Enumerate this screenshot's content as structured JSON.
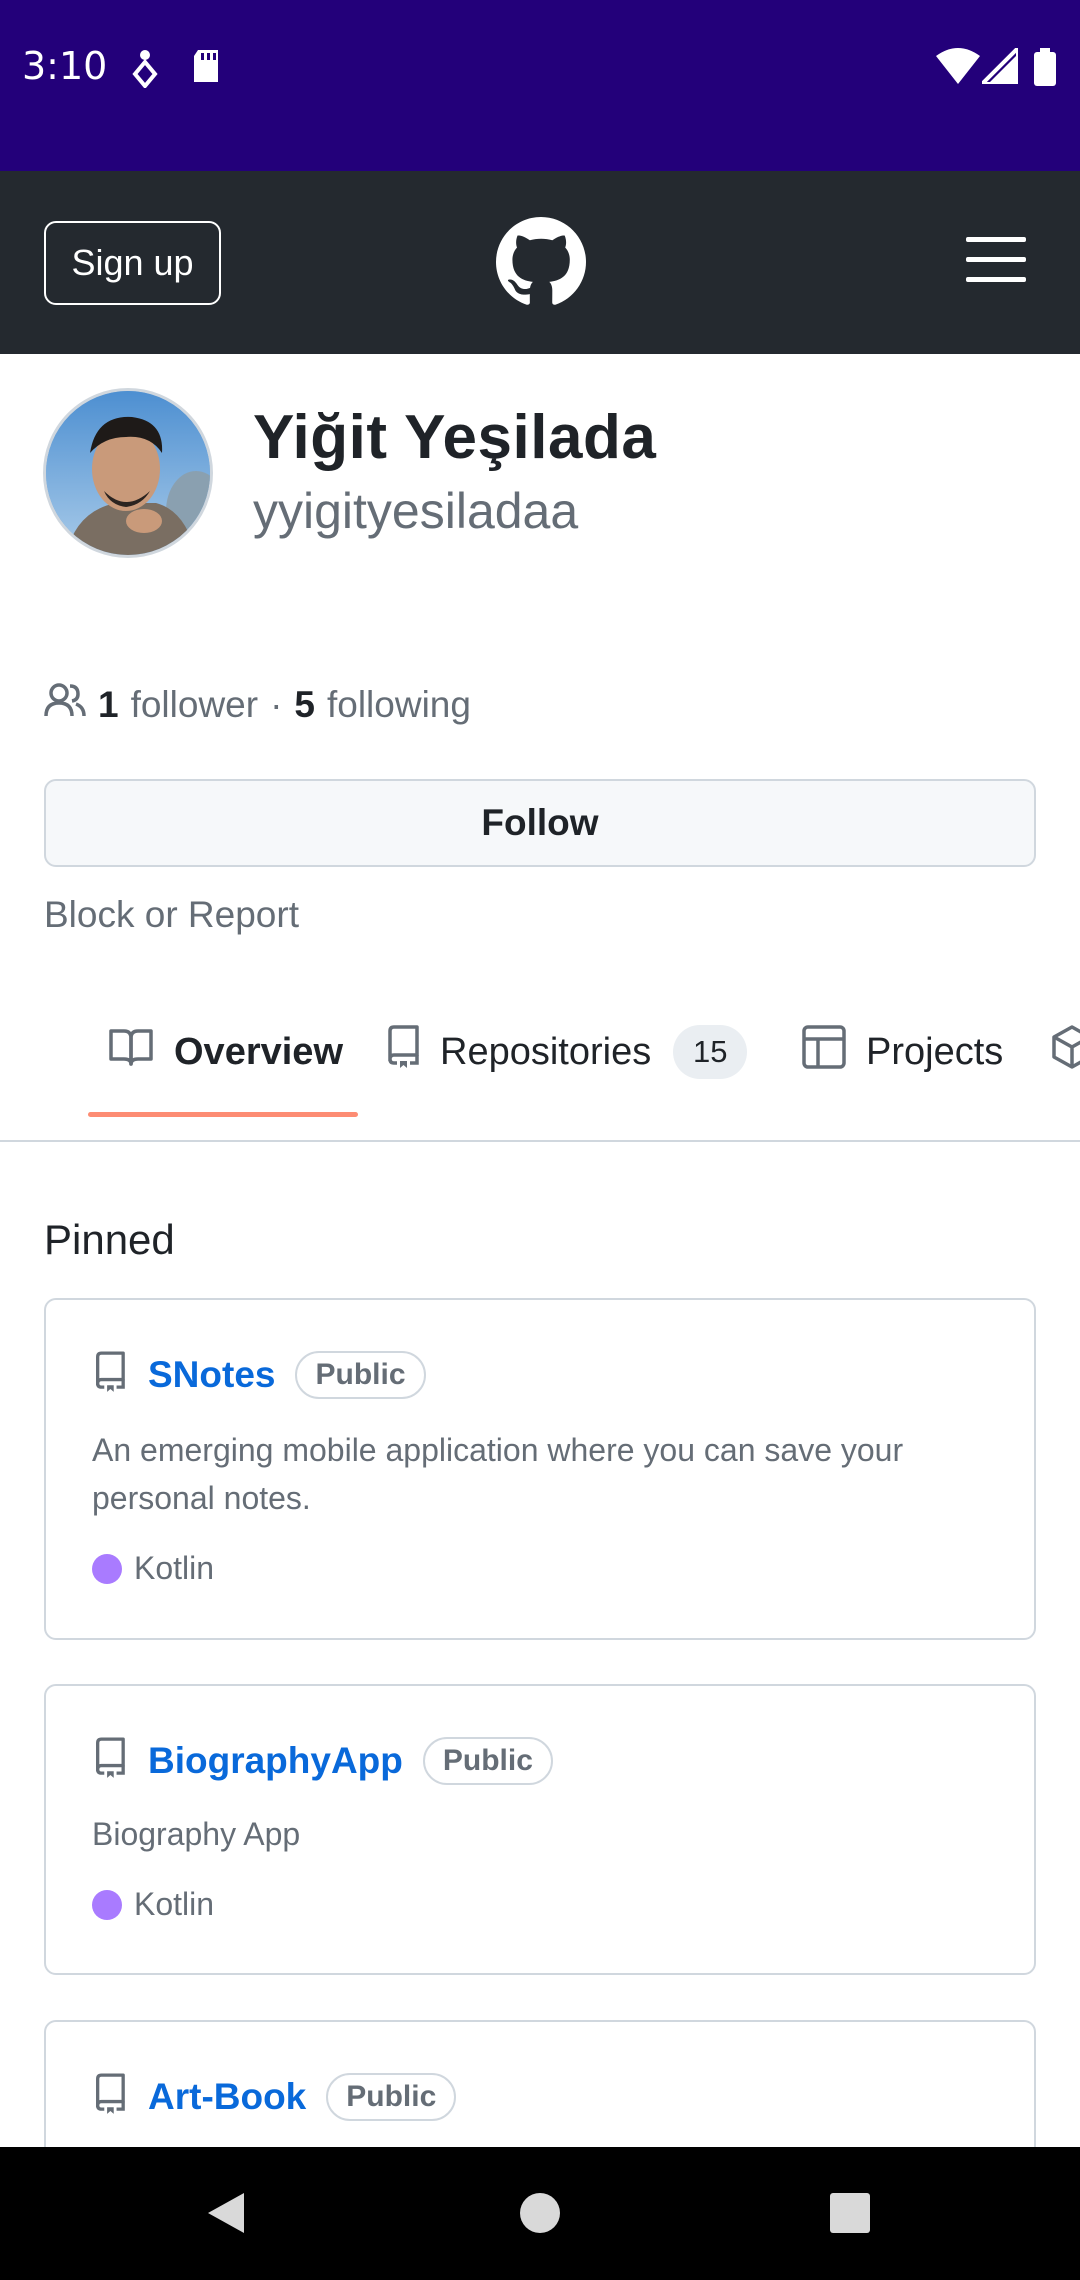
{
  "status_bar": {
    "time": "3:10",
    "background": "#23007a"
  },
  "header": {
    "signup_label": "Sign up",
    "logo_icon": "github-logo-icon",
    "menu_icon": "hamburger-menu-icon"
  },
  "profile": {
    "name": "Yiğit Yeşilada",
    "login": "yyigityesiladaa",
    "followers_count": "1",
    "followers_label": "follower",
    "separator": "·",
    "following_count": "5",
    "following_label": "following",
    "follow_label": "Follow",
    "block_label": "Block or Report"
  },
  "tabs": [
    {
      "label": "Overview",
      "icon": "book-icon",
      "active": true
    },
    {
      "label": "Repositories",
      "icon": "repo-icon",
      "count": "15"
    },
    {
      "label": "Projects",
      "icon": "table-icon"
    },
    {
      "label": "",
      "icon": "package-icon"
    }
  ],
  "pinned": {
    "title": "Pinned",
    "repos": [
      {
        "name": "SNotes",
        "visibility": "Public",
        "description": "An emerging mobile application where you can save your personal notes.",
        "language": "Kotlin",
        "language_color": "#a97bff"
      },
      {
        "name": "BiographyApp",
        "visibility": "Public",
        "description": "Biography App",
        "language": "Kotlin",
        "language_color": "#a97bff"
      },
      {
        "name": "Art-Book",
        "visibility": "Public"
      }
    ]
  },
  "colors": {
    "header_bg": "#24292f",
    "link": "#0969da",
    "tab_underline": "#fd8c73"
  }
}
